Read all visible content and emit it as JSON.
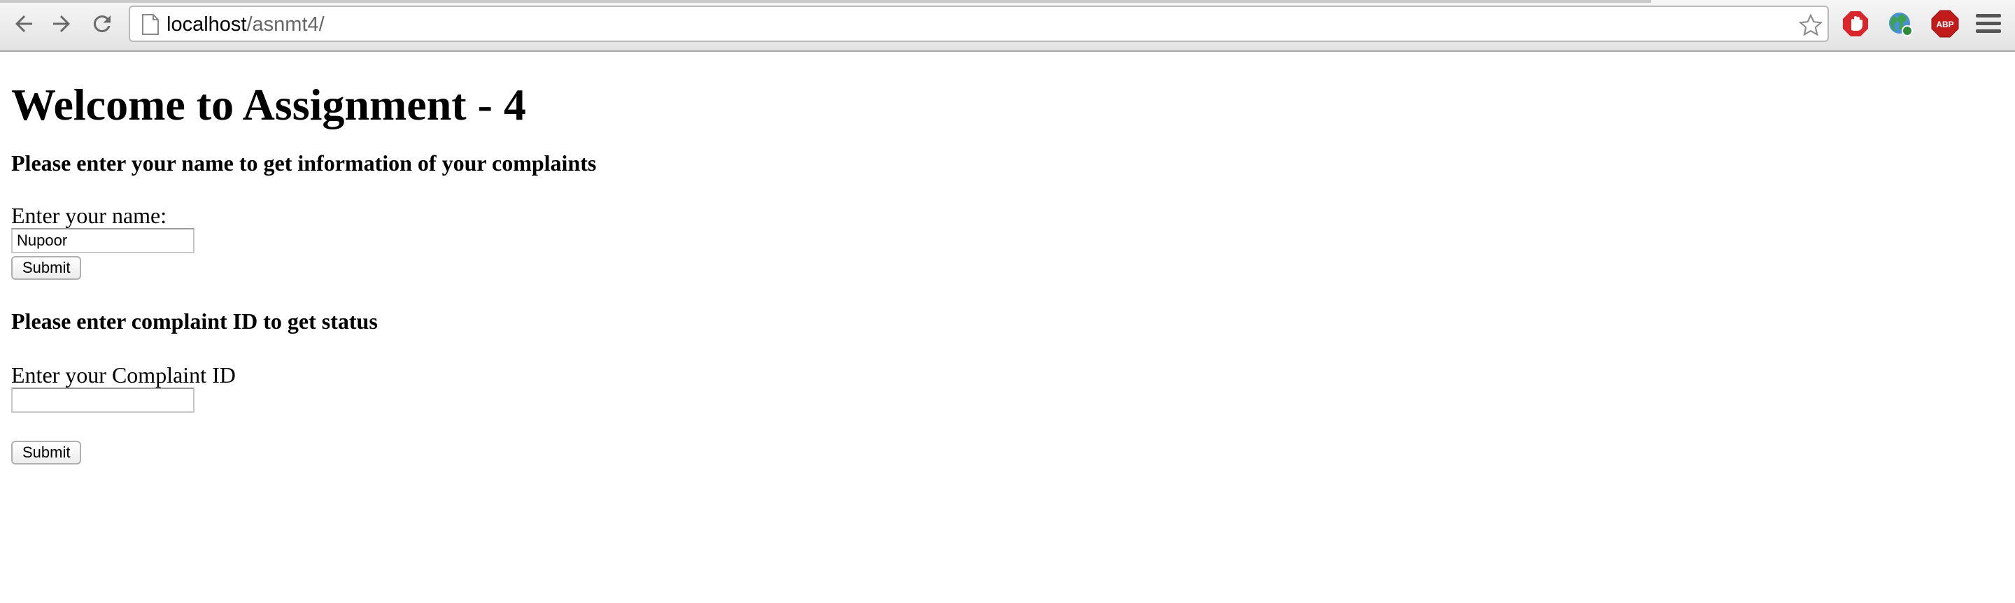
{
  "browser": {
    "url_host": "localhost",
    "url_path": "/asnmt4/",
    "extensions": [
      {
        "name": "adblock-hand-icon",
        "color": "#d8262c"
      },
      {
        "name": "globe-icon",
        "color": "#3b82c4"
      },
      {
        "name": "abp-icon",
        "label": "ABP",
        "color": "#c11b1b"
      }
    ]
  },
  "page": {
    "title": "Welcome to Assignment - 4",
    "section1": {
      "heading": "Please enter your name to get information of your complaints",
      "label": "Enter your name:",
      "input_value": "Nupoor",
      "submit_label": "Submit"
    },
    "section2": {
      "heading": "Please enter complaint ID to get status",
      "label": "Enter your Complaint ID",
      "input_value": "",
      "submit_label": "Submit"
    }
  }
}
